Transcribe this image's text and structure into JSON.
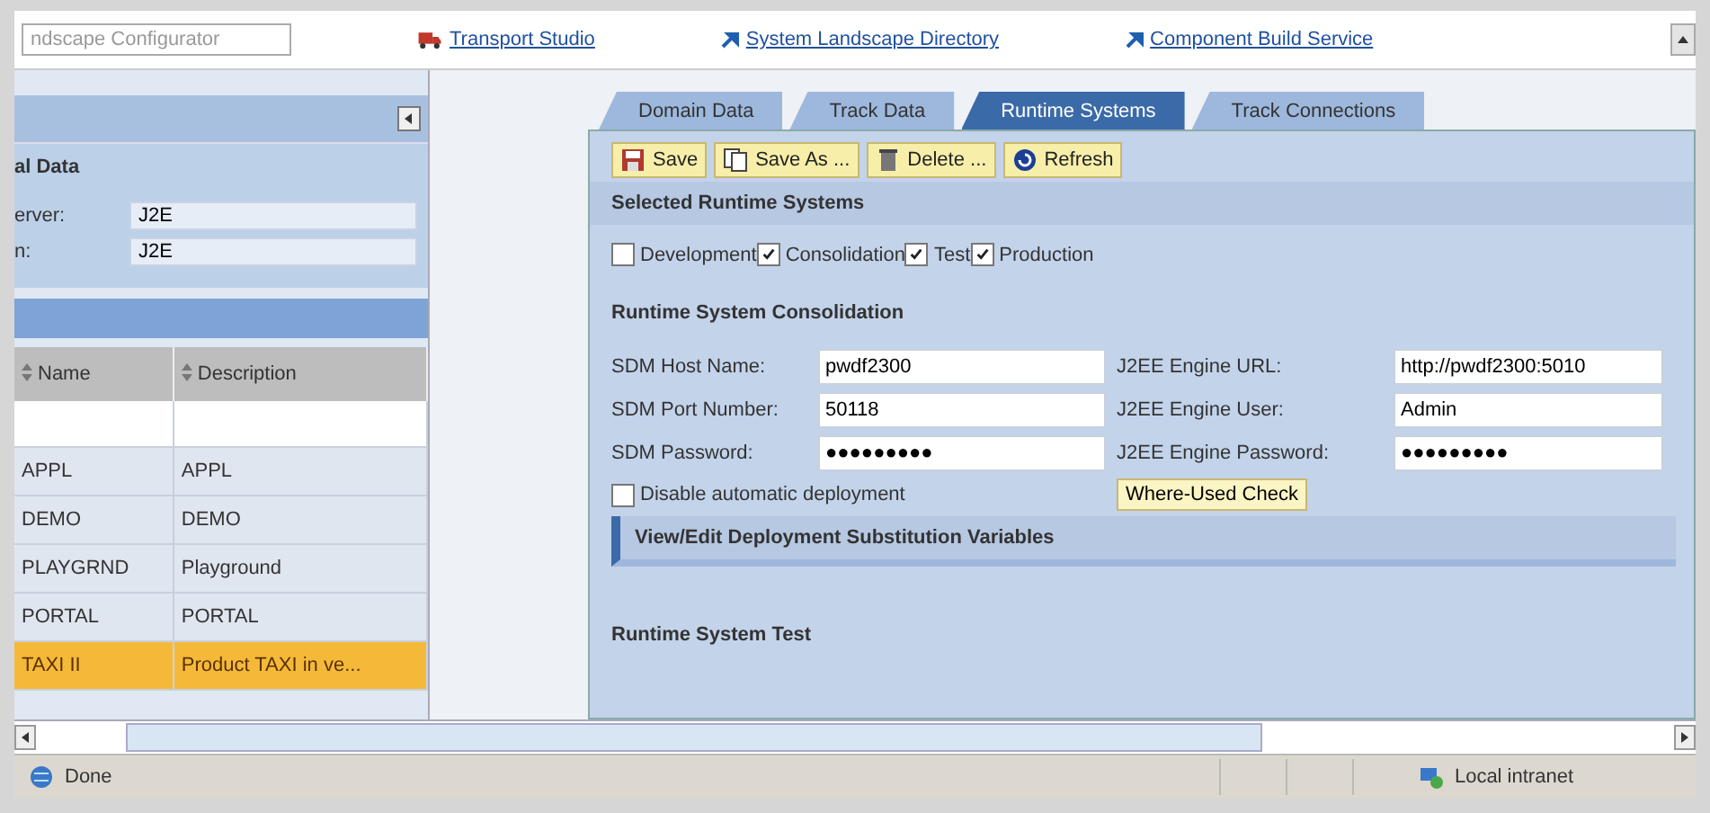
{
  "top_bar": {
    "field_value": "ndscape Configurator",
    "links": [
      {
        "label": "Transport Studio",
        "kind": "truck"
      },
      {
        "label": "System Landscape Directory",
        "kind": "arrow"
      },
      {
        "label": "Component Build Service",
        "kind": "arrow"
      }
    ]
  },
  "left_panel": {
    "section_title": "al Data",
    "fields": [
      {
        "label": "erver:",
        "value": "J2E"
      },
      {
        "label": "n:",
        "value": "J2E"
      }
    ],
    "table": {
      "columns": [
        "Name",
        "Description"
      ],
      "rows": [
        {
          "name": "APPL",
          "description": "APPL",
          "selected": false
        },
        {
          "name": "DEMO",
          "description": "DEMO",
          "selected": false
        },
        {
          "name": "PLAYGRND",
          "description": "Playground",
          "selected": false
        },
        {
          "name": "PORTAL",
          "description": "PORTAL",
          "selected": false
        },
        {
          "name": "TAXI II",
          "description": "Product TAXI in ve...",
          "selected": true
        }
      ]
    }
  },
  "tabs": [
    {
      "label": "Domain Data",
      "selected": false
    },
    {
      "label": "Track Data",
      "selected": false
    },
    {
      "label": "Runtime Systems",
      "selected": true
    },
    {
      "label": "Track Connections",
      "selected": false
    }
  ],
  "toolbar": [
    {
      "label": "Save",
      "kind": "save"
    },
    {
      "label": "Save As ...",
      "kind": "copy"
    },
    {
      "label": "Delete ...",
      "kind": "delete"
    },
    {
      "label": "Refresh",
      "kind": "refresh"
    }
  ],
  "selected_systems": {
    "title": "Selected Runtime Systems",
    "options": [
      {
        "label": "Development",
        "checked": false
      },
      {
        "label": "Consolidation",
        "checked": true
      },
      {
        "label": "Test",
        "checked": true
      },
      {
        "label": "Production",
        "checked": true
      }
    ]
  },
  "consolidation": {
    "title": "Runtime System Consolidation",
    "left_fields": [
      {
        "label": "SDM Host Name:",
        "value": "pwdf2300"
      },
      {
        "label": "SDM Port Number:",
        "value": "50118"
      },
      {
        "label": "SDM Password:",
        "value": "●●●●●●●●●"
      }
    ],
    "right_fields": [
      {
        "label": "J2EE Engine URL:",
        "value": "http://pwdf2300:5010"
      },
      {
        "label": "J2EE Engine User:",
        "value": "Admin"
      },
      {
        "label": "J2EE Engine Password:",
        "value": "●●●●●●●●●"
      }
    ],
    "disable_auto": {
      "label": "Disable automatic deployment",
      "checked": false
    },
    "check_button": "Where-Used Check",
    "subsection": "View/Edit Deployment Substitution Variables"
  },
  "test_title": "Runtime System Test",
  "status_bar": {
    "text": "Done",
    "zone": "Local intranet"
  }
}
